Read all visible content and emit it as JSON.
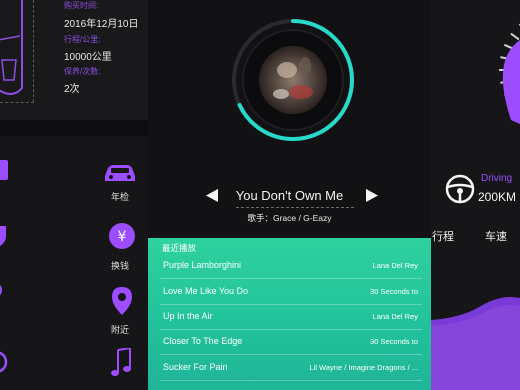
{
  "vehicle_info": {
    "purchase_label": "购买时间:",
    "purchase_value": "2016年12月10日",
    "mileage_label": "行程/公里:",
    "mileage_value": "10000公里",
    "maintenance_label": "保养/次数:",
    "maintenance_value": "2次"
  },
  "menu": {
    "annual_inspection": "年检",
    "exchange": "换钱",
    "nearby": "附近"
  },
  "player": {
    "song_title": "You Don't Own Me",
    "artist_line": "歌手：Grace / G-Eazy",
    "progress": 0.68
  },
  "playlist": {
    "heading": "最近播放",
    "items": [
      {
        "title": "Purple Lamborghini",
        "artist": "Lana Del Rey"
      },
      {
        "title": "Love Me Like You Do",
        "artist": "30 Seconds to"
      },
      {
        "title": "Up In the Air",
        "artist": "Lana Del Rey"
      },
      {
        "title": "Closer To The Edge",
        "artist": "30 Seconds to"
      },
      {
        "title": "Sucker For Pain",
        "artist": "Lil Wayne / Imagine Dragons / ..."
      }
    ]
  },
  "dashboard": {
    "mode": "Driving",
    "range": "200KM",
    "tab_trip": "行程",
    "tab_speed": "车速"
  },
  "colors": {
    "accent_purple": "#9b4dff",
    "accent_teal": "#25c8a0",
    "ring_teal": "#27d9c8"
  }
}
